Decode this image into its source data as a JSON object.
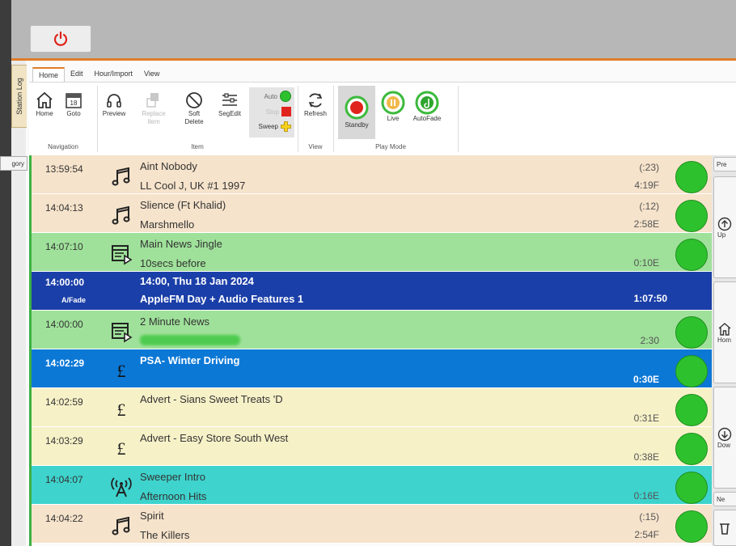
{
  "app": {
    "power_icon": "power-icon",
    "side_tab": "Station Log",
    "category_tag": "gory"
  },
  "ribbon": {
    "tabs": [
      {
        "label": "Home",
        "active": true
      },
      {
        "label": "Edit",
        "active": false
      },
      {
        "label": "Hour/Import",
        "active": false
      },
      {
        "label": "View",
        "active": false
      }
    ],
    "navigation": {
      "group_label": "Navigation",
      "home_label": "Home",
      "goto_label": "Goto",
      "calendar_day": "18"
    },
    "item": {
      "group_label": "Item",
      "preview_label": "Preview",
      "replace_label_1": "Replace",
      "replace_label_2": "Item",
      "soft_delete_1": "Soft",
      "soft_delete_2": "Delete",
      "segedit_label": "SegEdit",
      "auto_label": "Auto",
      "stop_label": "Stop",
      "sweep_label": "Sweep"
    },
    "view": {
      "group_label": "View",
      "refresh_label": "Refresh"
    },
    "play_mode": {
      "group_label": "Play Mode",
      "standby_label": "Standby",
      "live_label": "Live",
      "autofade_label": "AutoFade"
    }
  },
  "side_panel": {
    "prev_label": "Pre",
    "up_label": "Up",
    "home_label": "Hom",
    "down_label": "Dow",
    "next_label": "Ne"
  },
  "log": {
    "rows": [
      {
        "type": "song",
        "time": "13:59:54",
        "icon": "music-note-icon",
        "title": "Aint Nobody",
        "artist": "LL Cool J, UK #1 1997",
        "intro": "(:23)",
        "duration": "4:19F",
        "bg": "#f6e3cb",
        "status": "ready"
      },
      {
        "type": "song",
        "time": "14:04:13",
        "icon": "music-note-icon",
        "title": "Slience (Ft Khalid)",
        "artist": "Marshmello",
        "intro": "(:12)",
        "duration": "2:58E",
        "bg": "#f6e3cb",
        "status": "ready"
      },
      {
        "type": "jingle",
        "time": "14:07:10",
        "icon": "playlist-icon",
        "title": "Main News Jingle",
        "artist": "10secs before",
        "intro": "",
        "duration": "0:10E",
        "bg": "#9fe19a",
        "status": "ready"
      },
      {
        "type": "header",
        "time": "14:00:00",
        "sub_time": "A/Fade",
        "title": "14:00, Thu 18 Jan 2024",
        "artist": "AppleFM Day + Audio Features 1",
        "duration": "1:07:50",
        "bg": "#1b3fa8"
      },
      {
        "type": "news",
        "time": "14:00:00",
        "icon": "playlist-icon",
        "title": "2 Minute News",
        "artist": "",
        "intro": "",
        "duration": "2:30",
        "bg": "#9fe19a",
        "status": "ready",
        "redacted": true
      },
      {
        "type": "selected",
        "time": "14:02:29",
        "icon": "pound-icon",
        "title": "PSA- Winter Driving",
        "artist": "",
        "intro": "",
        "duration": "0:30E",
        "bg": "#0c78d6",
        "status": "ready"
      },
      {
        "type": "advert",
        "time": "14:02:59",
        "icon": "pound-icon",
        "title": "Advert - Sians Sweet Treats 'D",
        "artist": "",
        "intro": "",
        "duration": "0:31E",
        "bg": "#f7f1c8",
        "status": "ready"
      },
      {
        "type": "advert",
        "time": "14:03:29",
        "icon": "pound-icon",
        "title": "Advert - Easy Store South West",
        "artist": "",
        "intro": "",
        "duration": "0:38E",
        "bg": "#f7f1c8",
        "status": "ready"
      },
      {
        "type": "sweeper",
        "time": "14:04:07",
        "icon": "broadcast-icon",
        "title": "Sweeper Intro",
        "artist": "Afternoon Hits",
        "intro": "",
        "duration": "0:16E",
        "bg": "#3ed3cd",
        "status": "ready"
      },
      {
        "type": "song",
        "time": "14:04:22",
        "icon": "music-note-icon",
        "title": "Spirit",
        "artist": "The Killers",
        "intro": "(:15)",
        "duration": "2:54F",
        "bg": "#f6e3cb",
        "status": "ready"
      }
    ]
  }
}
